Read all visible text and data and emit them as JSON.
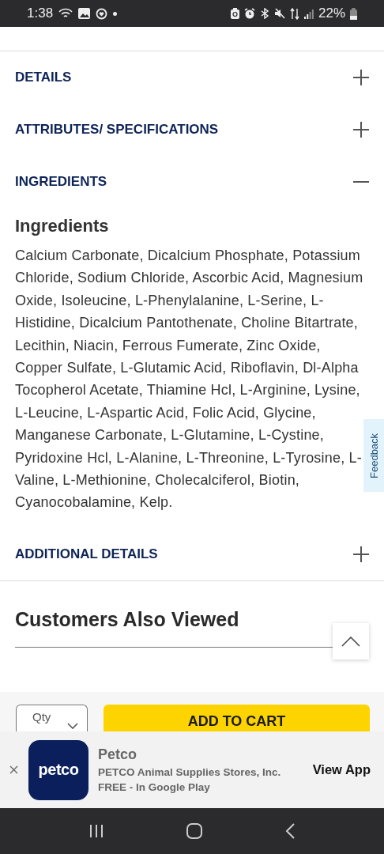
{
  "status_bar": {
    "time": "1:38",
    "battery": "22%"
  },
  "accordion": [
    {
      "title": "DETAILS",
      "expanded": false
    },
    {
      "title": "ATTRIBUTES/ SPECIFICATIONS",
      "expanded": false
    },
    {
      "title": "INGREDIENTS",
      "expanded": true,
      "heading": "Ingredients",
      "body": "Calcium Carbonate, Dicalcium Phosphate, Potassium Chloride, Sodium Chloride, Ascorbic Acid, Magnesium Oxide, Isoleucine, L-Phenylalanine, L-Serine, L-Histidine, Dicalcium Pantothenate, Choline Bitartrate, Lecithin, Niacin, Ferrous Fumerate, Zinc Oxide, Copper Sulfate, L-Glutamic Acid, Riboflavin, Dl-Alpha Tocopherol Acetate, Thiamine Hcl, L-Arginine, Lysine, L-Leucine, L-Aspartic Acid, Folic Acid, Glycine, Manganese Carbonate, L-Glutamine, L-Cystine, Pyridoxine Hcl, L-Alanine, L-Threonine, L-Tyrosine, L-Valine, L-Methionine, Cholecalciferol, Biotin, Cyanocobalamine, Kelp."
    },
    {
      "title": "ADDITIONAL DETAILS",
      "expanded": false
    }
  ],
  "feedback_tab": "Feedback",
  "section_title": "Customers Also Viewed",
  "cart_bar": {
    "qty_label": "Qty",
    "button": "ADD TO CART"
  },
  "app_banner": {
    "logo": "petco",
    "name": "Petco",
    "publisher": "PETCO Animal Supplies Stores, Inc.",
    "price": "FREE - In Google Play",
    "action": "View App"
  }
}
